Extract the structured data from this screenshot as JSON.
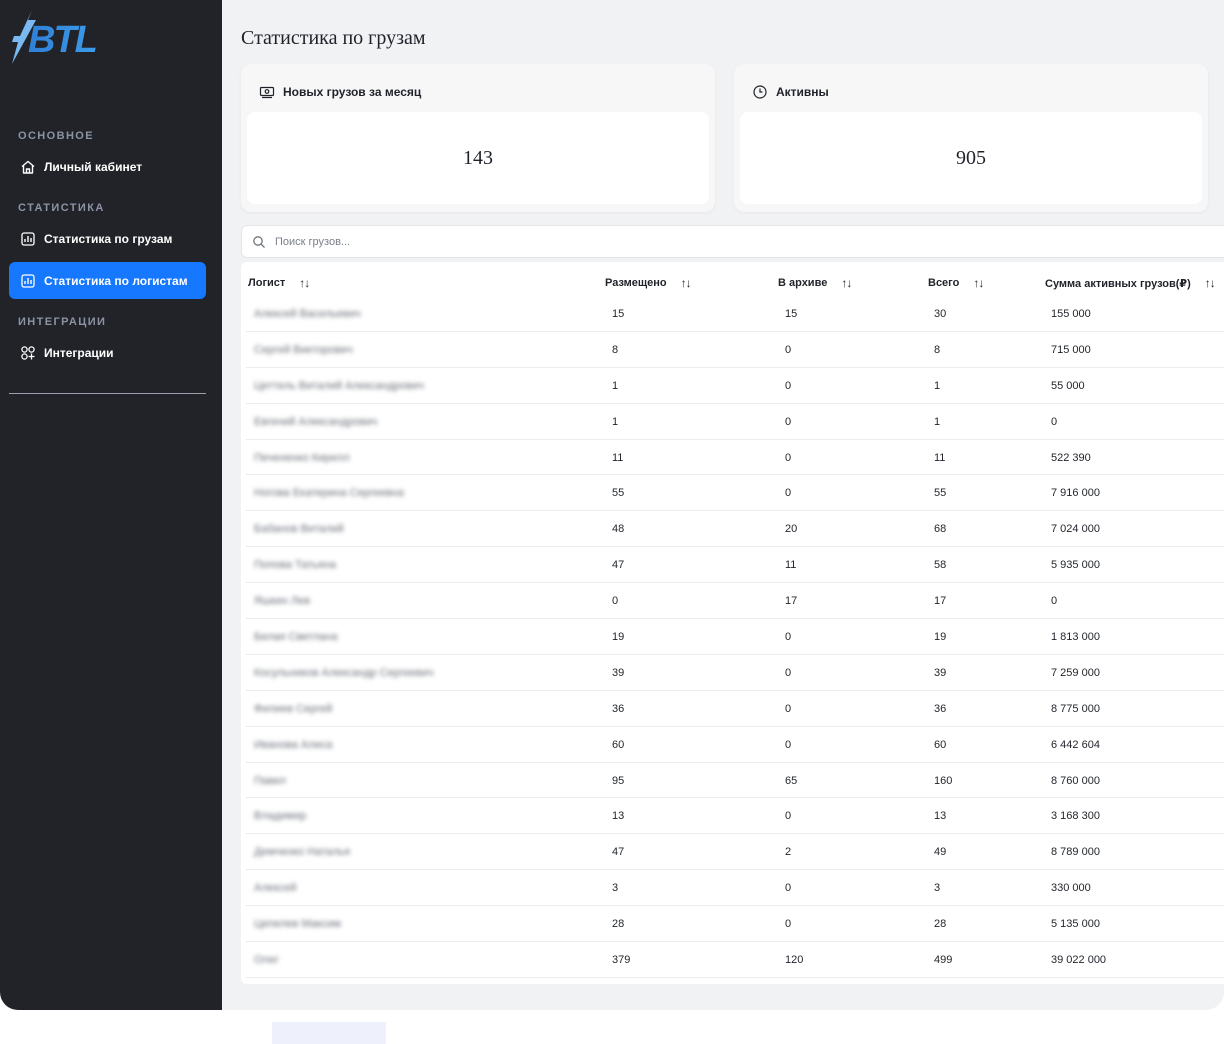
{
  "brand": {
    "logo_text": "BTL",
    "accent": "#1677ff",
    "sidebar_bg": "#212329"
  },
  "sidebar": {
    "sections": [
      {
        "title": "ОСНОВНОЕ"
      },
      {
        "title": "СТАТИСТИКА"
      },
      {
        "title": "ИНТЕГРАЦИИ"
      }
    ],
    "items": [
      {
        "label": "Личный кабинет",
        "icon": "home-icon"
      },
      {
        "label": "Статистика по грузам",
        "icon": "bar-chart-icon"
      },
      {
        "label": "Статистика по логистам",
        "icon": "bar-chart-icon",
        "active": true
      },
      {
        "label": "Интеграции",
        "icon": "apps-add-icon"
      }
    ]
  },
  "page": {
    "title": "Статистика по грузам"
  },
  "cards": [
    {
      "label": "Новых грузов за месяц",
      "value": "143",
      "icon": "money-icon"
    },
    {
      "label": "Активны",
      "value": "905",
      "icon": "clock-icon"
    }
  ],
  "search": {
    "placeholder": "Поиск грузов..."
  },
  "table": {
    "columns": [
      "Логист",
      "Размещено",
      "В архиве",
      "Всего",
      "Сумма активных грузов(₽)"
    ],
    "rows": [
      {
        "name": "Алексей Васильевич",
        "placed": "15",
        "archived": "15",
        "total": "30",
        "sum": "155 000"
      },
      {
        "name": "Сергей Викторович",
        "placed": "8",
        "archived": "0",
        "total": "8",
        "sum": "715 000"
      },
      {
        "name": "Цеттель Виталий Александрович",
        "placed": "1",
        "archived": "0",
        "total": "1",
        "sum": "55 000"
      },
      {
        "name": "Евгений Александрович",
        "placed": "1",
        "archived": "0",
        "total": "1",
        "sum": "0"
      },
      {
        "name": "Печененко Кирилл",
        "placed": "11",
        "archived": "0",
        "total": "11",
        "sum": "522 390"
      },
      {
        "name": "Ногова Екатерина Сергеевна",
        "placed": "55",
        "archived": "0",
        "total": "55",
        "sum": "7 916 000"
      },
      {
        "name": "Бабанов Виталий",
        "placed": "48",
        "archived": "20",
        "total": "68",
        "sum": "7 024 000"
      },
      {
        "name": "Попова Татьяна",
        "placed": "47",
        "archived": "11",
        "total": "58",
        "sum": "5 935 000"
      },
      {
        "name": "Яшкин Лев",
        "placed": "0",
        "archived": "17",
        "total": "17",
        "sum": "0"
      },
      {
        "name": "Белая Светлана",
        "placed": "19",
        "archived": "0",
        "total": "19",
        "sum": "1 813 000"
      },
      {
        "name": "Косульников Александр Сергеевич",
        "placed": "39",
        "archived": "0",
        "total": "39",
        "sum": "7 259 000"
      },
      {
        "name": "Филиев Сергей",
        "placed": "36",
        "archived": "0",
        "total": "36",
        "sum": "8 775 000"
      },
      {
        "name": "Иванова Алиса",
        "placed": "60",
        "archived": "0",
        "total": "60",
        "sum": "6 442 604"
      },
      {
        "name": "Павел",
        "placed": "95",
        "archived": "65",
        "total": "160",
        "sum": "8 760 000"
      },
      {
        "name": "Владимир",
        "placed": "13",
        "archived": "0",
        "total": "13",
        "sum": "3 168 300"
      },
      {
        "name": "Демченко Наталья",
        "placed": "47",
        "archived": "2",
        "total": "49",
        "sum": "8 789 000"
      },
      {
        "name": "Алексей",
        "placed": "3",
        "archived": "0",
        "total": "3",
        "sum": "330 000"
      },
      {
        "name": "Цепелев Максим",
        "placed": "28",
        "archived": "0",
        "total": "28",
        "sum": "5 135 000"
      },
      {
        "name": "Олег",
        "placed": "379",
        "archived": "120",
        "total": "499",
        "sum": "39 022 000"
      }
    ]
  }
}
